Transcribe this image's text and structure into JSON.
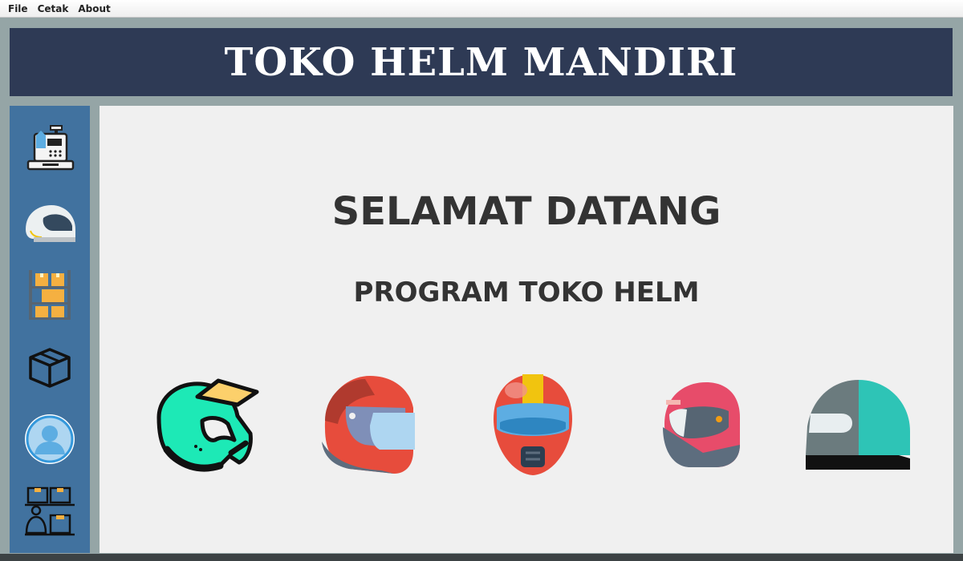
{
  "menu": {
    "items": [
      "File",
      "Cetak",
      "About"
    ]
  },
  "header": {
    "title": "TOKO HELM MANDIRI"
  },
  "sidebar": {
    "items": [
      {
        "icon": "cash-register-icon"
      },
      {
        "icon": "helmet-icon"
      },
      {
        "icon": "warehouse-shelf-icon"
      },
      {
        "icon": "box-icon"
      },
      {
        "icon": "user-profile-icon"
      },
      {
        "icon": "staff-inventory-icon"
      }
    ]
  },
  "main": {
    "welcome": "SELAMAT DATANG",
    "subtitle": "PROGRAM TOKO HELM",
    "helmets": [
      {
        "icon": "motocross-helmet-icon"
      },
      {
        "icon": "red-sport-helmet-icon"
      },
      {
        "icon": "full-face-helmet-icon"
      },
      {
        "icon": "racing-helmet-icon"
      },
      {
        "icon": "teal-half-helmet-icon"
      }
    ]
  },
  "colors": {
    "header_bg": "#2e3a55",
    "sidebar_bg": "#41729f",
    "main_bg": "#f0f0f0",
    "frame_bg": "#95a5a6"
  }
}
